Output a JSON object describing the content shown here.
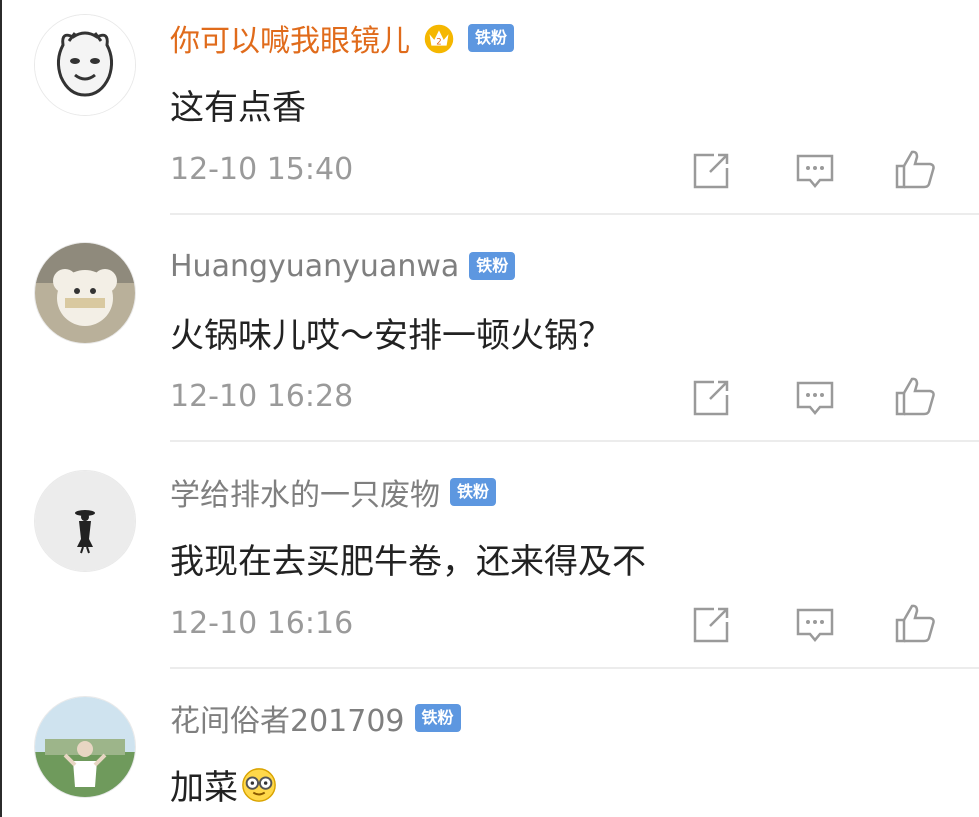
{
  "badge_label": "铁粉",
  "colors": {
    "vip_name": "#e06b1b",
    "normal_name": "#7f7f7f",
    "badge_bg": "#5d97e0",
    "time": "#9a9a9a",
    "text": "#222222"
  },
  "icons": {
    "share": "share-square-icon",
    "comment": "comment-bubble-icon",
    "like": "thumbs-up-icon",
    "vip": "crown-vip-icon",
    "emoji": "glasses-smile-emoji"
  },
  "comments": [
    {
      "username": "你可以喊我眼镜儿",
      "vip": true,
      "text": "这有点香",
      "time": "12-10 15:40"
    },
    {
      "username": "Huangyuanyuanwa",
      "vip": false,
      "text": "火锅味儿哎～安排一顿火锅？",
      "time": "12-10 16:28"
    },
    {
      "username": "学给排水的一只废物",
      "vip": false,
      "text": "我现在去买肥牛卷，还来得及不",
      "time": "12-10 16:16"
    },
    {
      "username": "花间俗者201709",
      "vip": false,
      "text": "加菜",
      "time": "",
      "emoji": "glasses-smile-emoji"
    }
  ]
}
